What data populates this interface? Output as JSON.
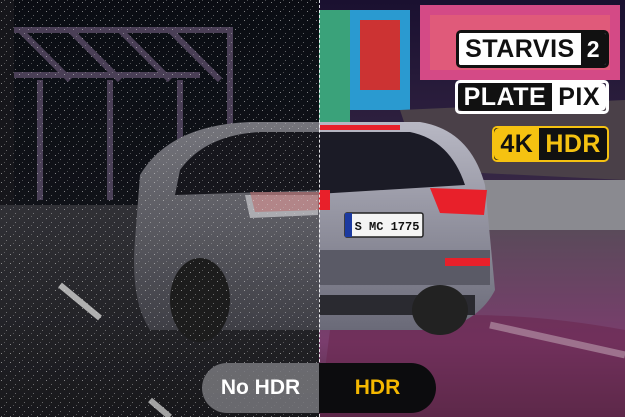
{
  "badges": {
    "starvis": {
      "word": "STARVIS",
      "number": "2"
    },
    "platepix": {
      "left": "PLATE",
      "right": "PIX"
    },
    "hdr4k": {
      "left": "4K",
      "right": "HDR"
    }
  },
  "plate": {
    "text": "S MC 1775"
  },
  "toggle": {
    "off_label": "No HDR",
    "on_label": "HDR"
  },
  "colors": {
    "accent_yellow": "#f5c211",
    "hdr_label": "#f5b800",
    "taillight_red": "#e8202a"
  }
}
